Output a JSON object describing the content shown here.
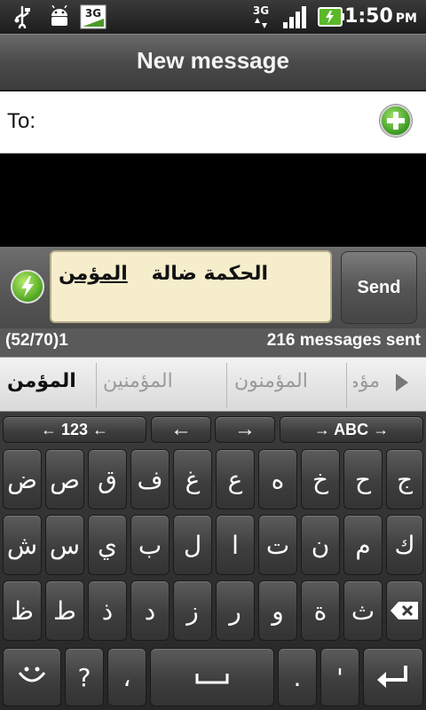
{
  "status_bar": {
    "time": "1:50",
    "ampm": "PM",
    "net_left": "3G",
    "net_right": "3G",
    "icons": [
      "usb-icon",
      "android-debug-icon",
      "3g-icon",
      "3g-data-icon",
      "signal-icon",
      "battery-charging-icon"
    ]
  },
  "header": {
    "title": "New message"
  },
  "recipient": {
    "label": "To:",
    "value": "",
    "add_icon": "add-contact-icon"
  },
  "compose": {
    "text": "الحكمة ضالة",
    "composing_word": "المؤمن",
    "send_label": "Send",
    "attach_icon": "flash-icon"
  },
  "counters": {
    "chars": "(52/70)1",
    "sent": "216 messages sent"
  },
  "suggestions": [
    "المؤمن",
    "المؤمنين",
    "المؤمنون",
    "مؤمن"
  ],
  "keyboard": {
    "top_row": [
      "← 123 ←",
      "←",
      "→",
      "→ ABC →"
    ],
    "row1": [
      "ض",
      "ص",
      "ق",
      "ف",
      "غ",
      "ع",
      "ه",
      "خ",
      "ح",
      "ج"
    ],
    "row2": [
      "ش",
      "س",
      "ي",
      "ب",
      "ل",
      "ا",
      "ت",
      "ن",
      "م",
      "ك"
    ],
    "row3": [
      "ظ",
      "ط",
      "ذ",
      "د",
      "ز",
      "ر",
      "و",
      "ة",
      "ث"
    ],
    "row4": [
      "?",
      "،",
      ".",
      "'"
    ],
    "icons": [
      "smiley-icon",
      "space-icon",
      "backspace-icon",
      "enter-icon"
    ]
  },
  "colors": {
    "accent_green": "#3a9a20",
    "compose_bg": "#f5edcc"
  }
}
